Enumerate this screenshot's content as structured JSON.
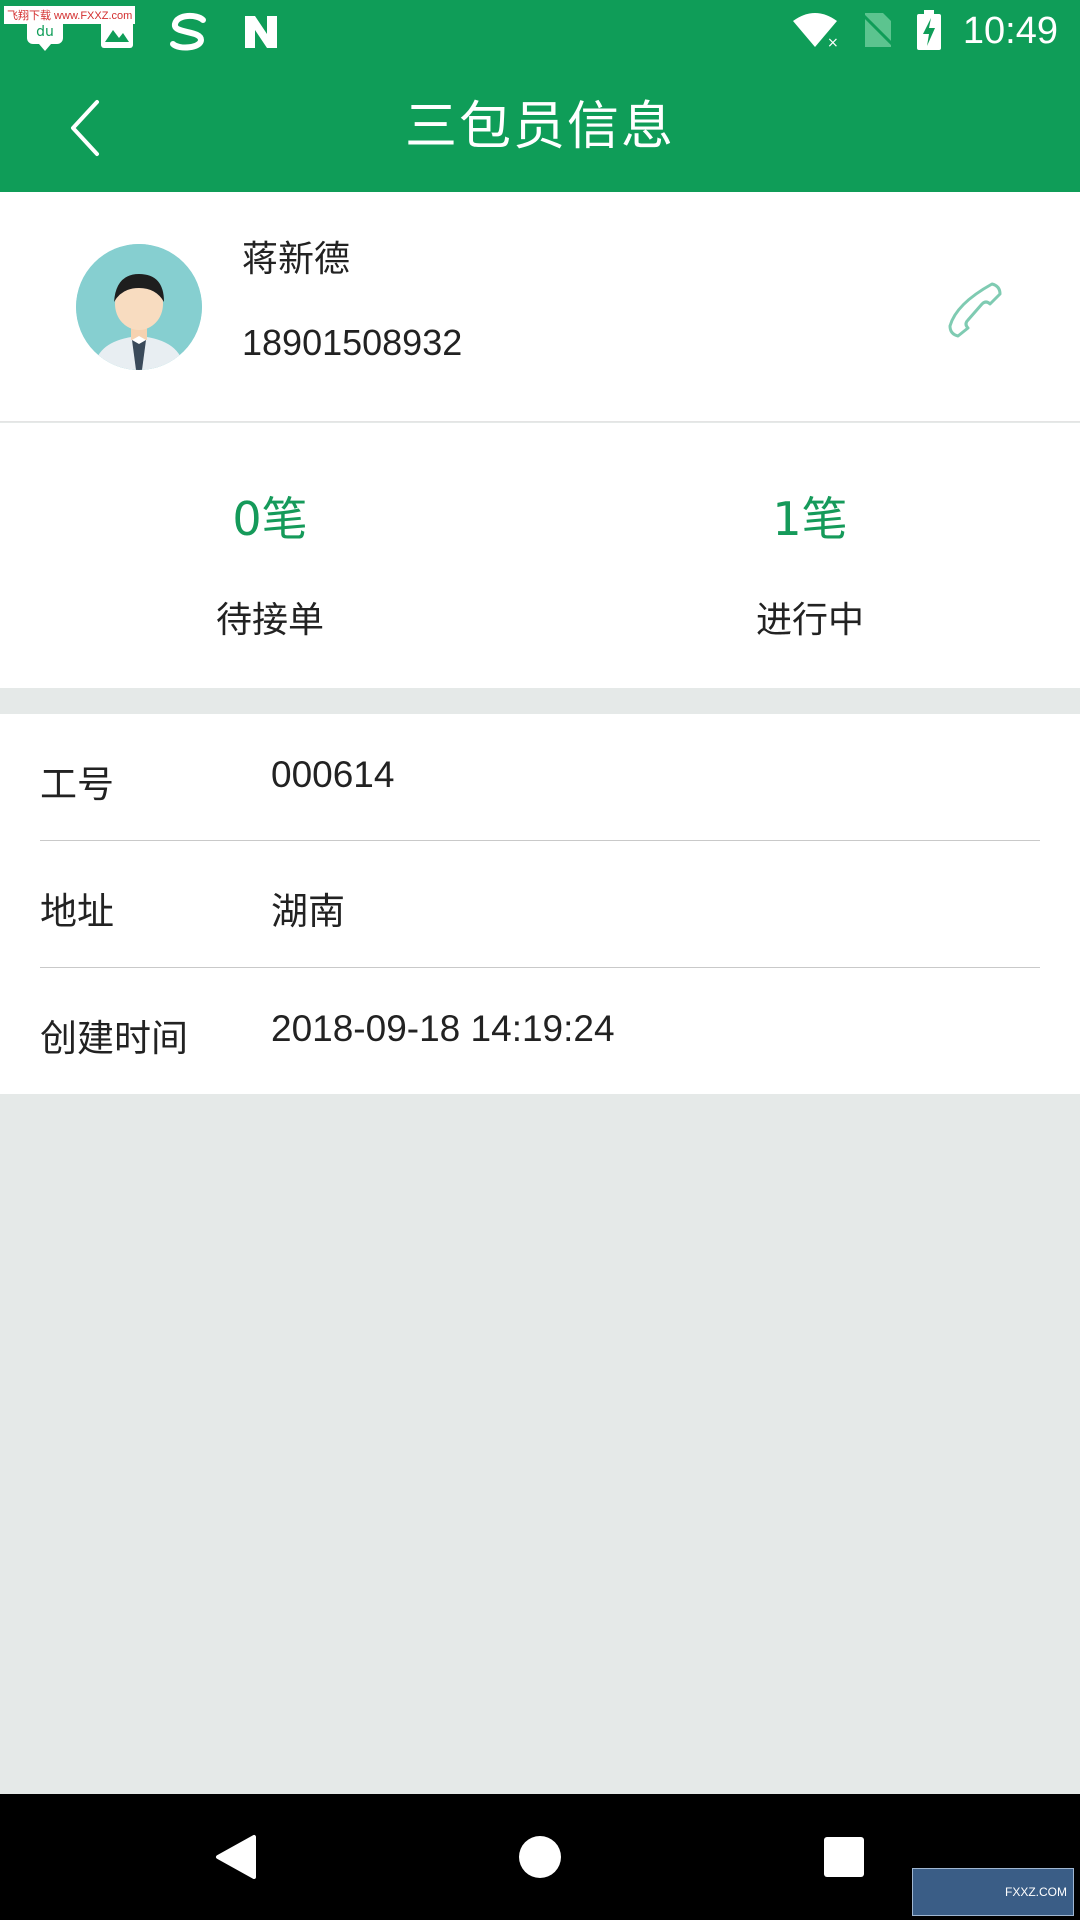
{
  "status_bar": {
    "time": "10:49",
    "watermark": "飞翔下载 www.FXXZ.com",
    "left_icons": [
      "du-icon",
      "image-icon",
      "sogou-icon",
      "n-icon"
    ],
    "right_icons": [
      "wifi-icon",
      "no-sim-icon",
      "battery-charging-icon"
    ]
  },
  "app_bar": {
    "title": "三包员信息"
  },
  "profile": {
    "name": "蒋新德",
    "phone": "18901508932"
  },
  "stats": [
    {
      "value": "0笔",
      "label": "待接单"
    },
    {
      "value": "1笔",
      "label": "进行中"
    }
  ],
  "info": [
    {
      "key": "工号",
      "value": "000614"
    },
    {
      "key": "地址",
      "value": "湖南"
    },
    {
      "key": "创建时间",
      "value": "2018-09-18 14:19:24"
    }
  ],
  "watermark_bottom": "FXXZ.COM",
  "colors": {
    "primary": "#0f9d58",
    "accent_text": "#159a5a",
    "background": "#e5e9e8",
    "call_icon": "#7fcbb2"
  }
}
